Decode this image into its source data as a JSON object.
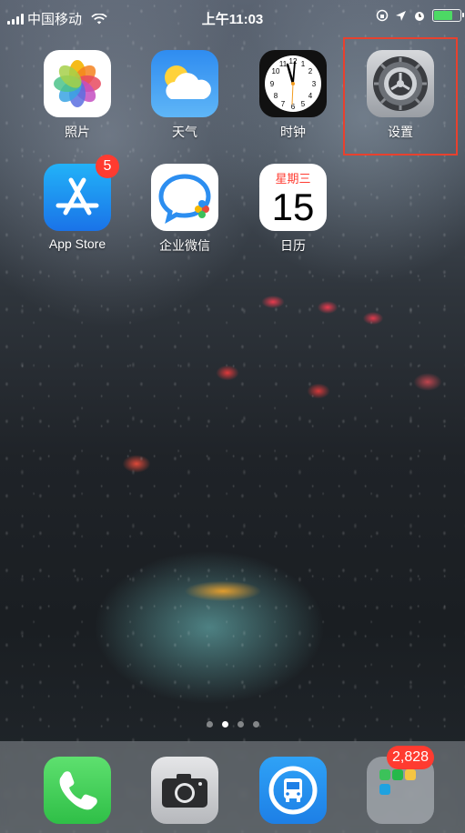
{
  "status_bar": {
    "carrier": "中国移动",
    "time": "上午11:03",
    "battery_level": 0.65
  },
  "home": {
    "apps": [
      {
        "name": "照片",
        "icon": "photos-icon"
      },
      {
        "name": "天气",
        "icon": "weather-icon"
      },
      {
        "name": "时钟",
        "icon": "clock-icon"
      },
      {
        "name": "设置",
        "icon": "settings-gear-icon"
      },
      {
        "name": "App Store",
        "icon": "app-store-icon",
        "badge": "5"
      },
      {
        "name": "企业微信",
        "icon": "wecom-icon"
      },
      {
        "name": "日历",
        "icon": "calendar-icon",
        "weekday": "星期三",
        "day": "15"
      }
    ],
    "page_count": 4,
    "active_page": 1
  },
  "dock": {
    "apps": [
      {
        "icon": "phone-icon"
      },
      {
        "icon": "camera-icon"
      },
      {
        "icon": "bus-app-icon"
      },
      {
        "icon": "folder-icon",
        "badge": "2,828"
      }
    ]
  },
  "colors": {
    "badge": "#ff3b30",
    "highlight": "#e8412e",
    "phone_green": "#34c759",
    "app_store_blue": "#1a8cf5"
  }
}
